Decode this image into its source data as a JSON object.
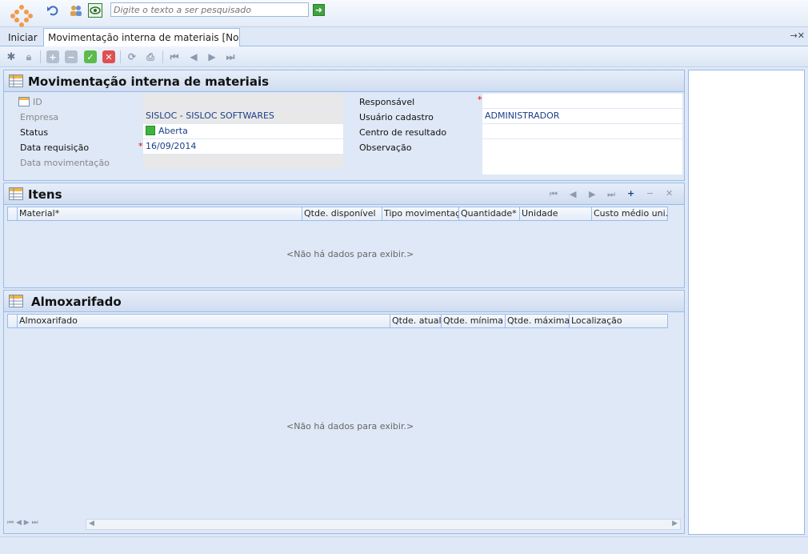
{
  "toolbar": {
    "search_placeholder": "Digite o texto a ser pesquisado"
  },
  "tabs": {
    "start_label": "Iniciar",
    "active_label": "Movimentação interna de materiais [No..."
  },
  "form": {
    "title": "Movimentação interna de materiais",
    "fields": {
      "id_label": "ID",
      "empresa_label": "Empresa",
      "empresa_value": "SISLOC - SISLOC SOFTWARES",
      "status_label": "Status",
      "status_value": "Aberta",
      "data_requisicao_label": "Data requisição",
      "data_requisicao_value": "16/09/2014",
      "data_movimentacao_label": "Data movimentação",
      "responsavel_label": "Responsável",
      "usuario_cadastro_label": "Usuário cadastro",
      "usuario_cadastro_value": "ADMINISTRADOR",
      "centro_resultado_label": "Centro de resultado",
      "observacao_label": "Observação"
    }
  },
  "itens": {
    "title": "Itens",
    "columns": [
      "Material*",
      "Qtde. disponível",
      "Tipo movimentação",
      "Quantidade*",
      "Unidade",
      "Custo médio uni."
    ],
    "empty_text": "<Não há dados para exibir.>"
  },
  "almoxarifado": {
    "title": "Almoxarifado",
    "columns": [
      "Almoxarifado",
      "Qtde. atual",
      "Qtde. mínima",
      "Qtde. máxima",
      "Localização"
    ],
    "empty_text": "<Não há dados para exibir.>"
  },
  "colors": {
    "status_green": "#3cb53c",
    "panel_border": "#99bbe8",
    "background": "#dfe8f6"
  }
}
